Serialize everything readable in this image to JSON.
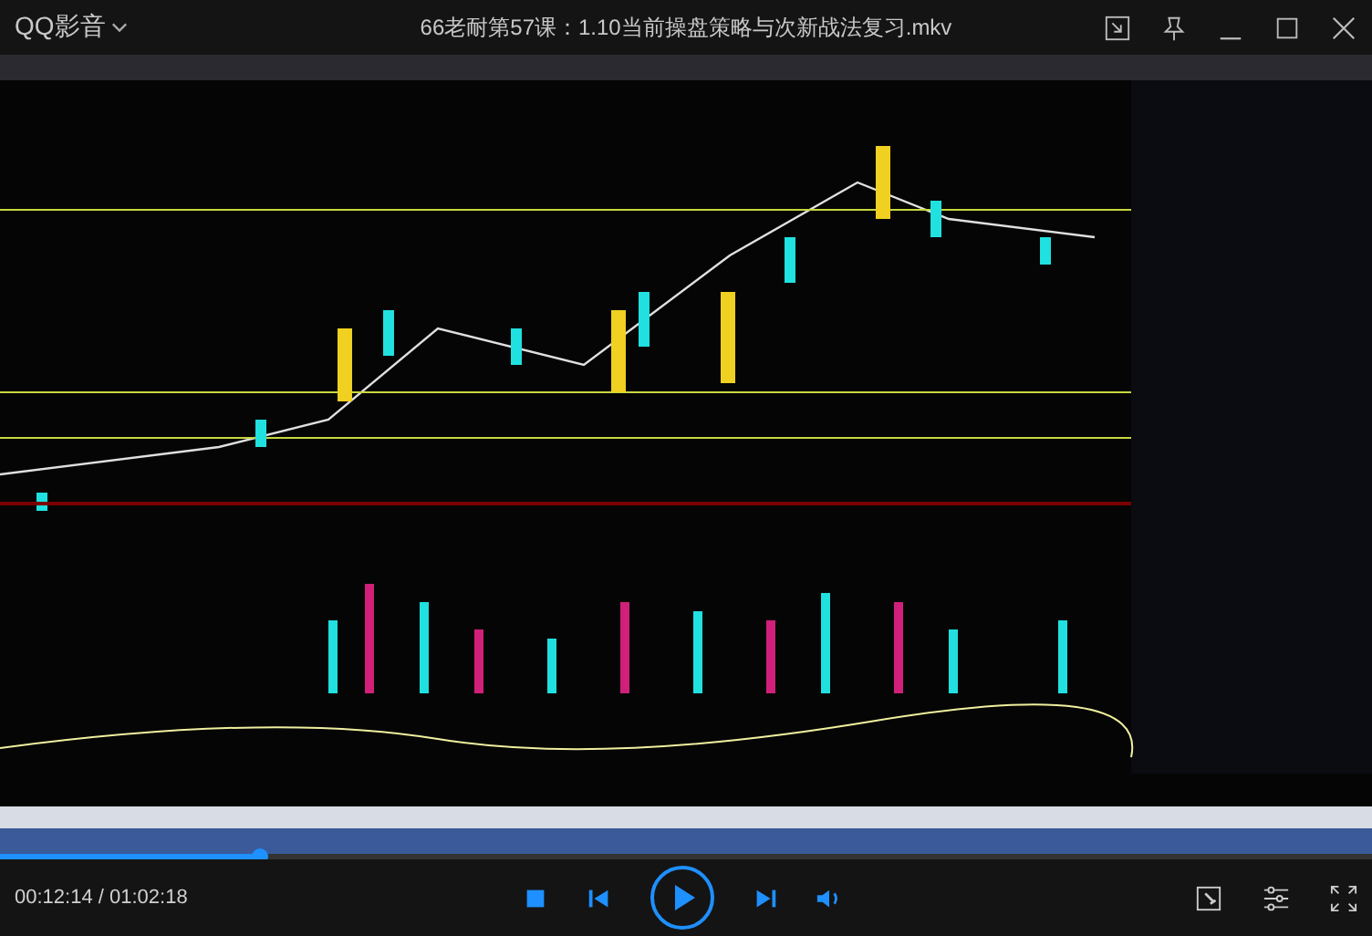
{
  "app": {
    "name": "QQ影音"
  },
  "window": {
    "title": "66老耐第57课：1.10当前操盘策略与次新战法复习.mkv"
  },
  "playback": {
    "level": 0.19,
    "time": "00:12:14 / 01:02:18"
  }
}
